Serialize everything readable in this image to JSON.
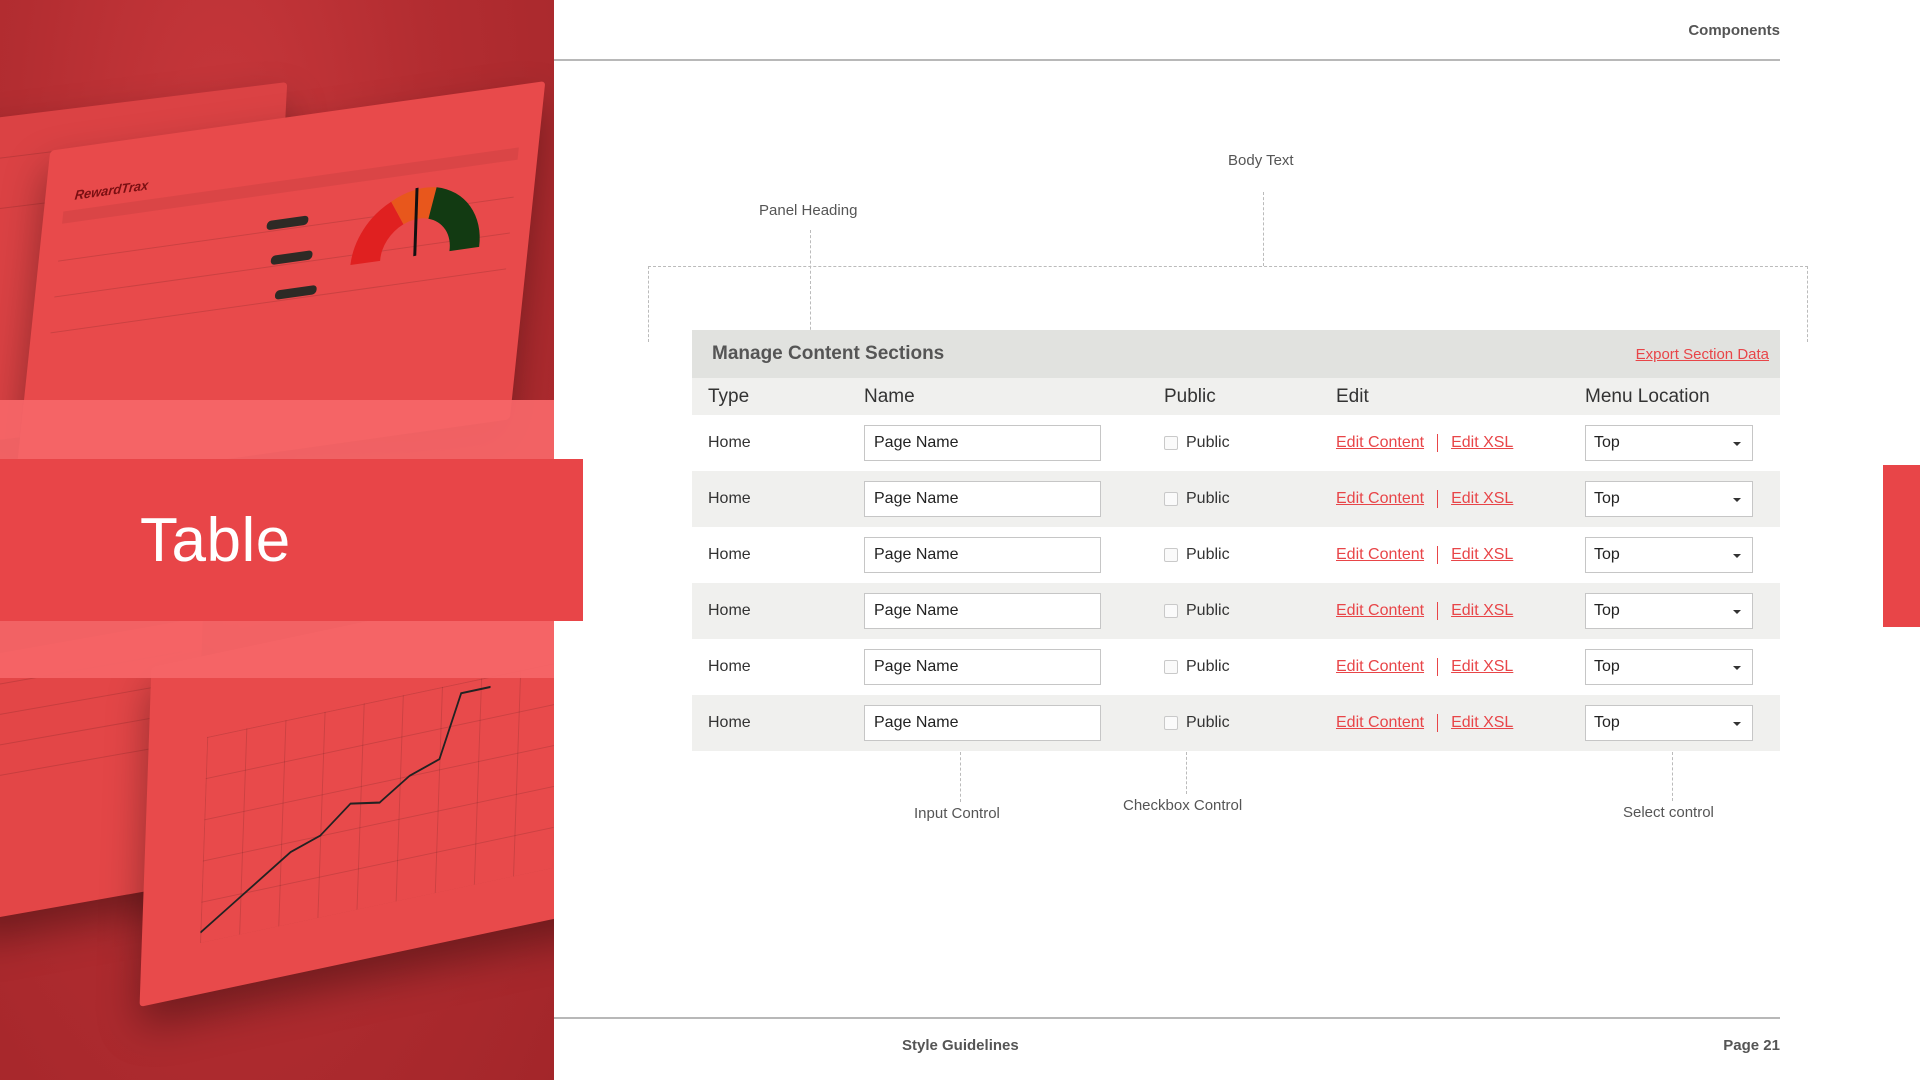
{
  "header": {
    "section": "Components"
  },
  "hero": {
    "title": "Table",
    "mock_logo": "RewardTrax"
  },
  "annotations": {
    "body_text": "Body Text",
    "panel_heading": "Panel Heading",
    "input_control": "Input Control",
    "checkbox_control": "Checkbox Control",
    "select_control": "Select control"
  },
  "panel": {
    "title": "Manage Content Sections",
    "export_link": "Export Section Data",
    "columns": [
      "Type",
      "Name",
      "Public",
      "Edit",
      "Menu Location"
    ],
    "rows": [
      {
        "type": "Home",
        "name": "Page Name",
        "public": "Public",
        "edit_content": "Edit Content",
        "edit_xsl": "Edit XSL",
        "location": "Top"
      },
      {
        "type": "Home",
        "name": "Page Name",
        "public": "Public",
        "edit_content": "Edit Content",
        "edit_xsl": "Edit XSL",
        "location": "Top"
      },
      {
        "type": "Home",
        "name": "Page Name",
        "public": "Public",
        "edit_content": "Edit Content",
        "edit_xsl": "Edit XSL",
        "location": "Top"
      },
      {
        "type": "Home",
        "name": "Page Name",
        "public": "Public",
        "edit_content": "Edit Content",
        "edit_xsl": "Edit XSL",
        "location": "Top"
      },
      {
        "type": "Home",
        "name": "Page Name",
        "public": "Public",
        "edit_content": "Edit Content",
        "edit_xsl": "Edit XSL",
        "location": "Top"
      },
      {
        "type": "Home",
        "name": "Page Name",
        "public": "Public",
        "edit_content": "Edit Content",
        "edit_xsl": "Edit XSL",
        "location": "Top"
      }
    ]
  },
  "footer": {
    "left": "Style Guidelines",
    "right": "Page 21"
  },
  "colors": {
    "accent": "#e84548",
    "panel_heading_bg": "#e1e2df",
    "row_alt_bg": "#f0f0ee"
  }
}
